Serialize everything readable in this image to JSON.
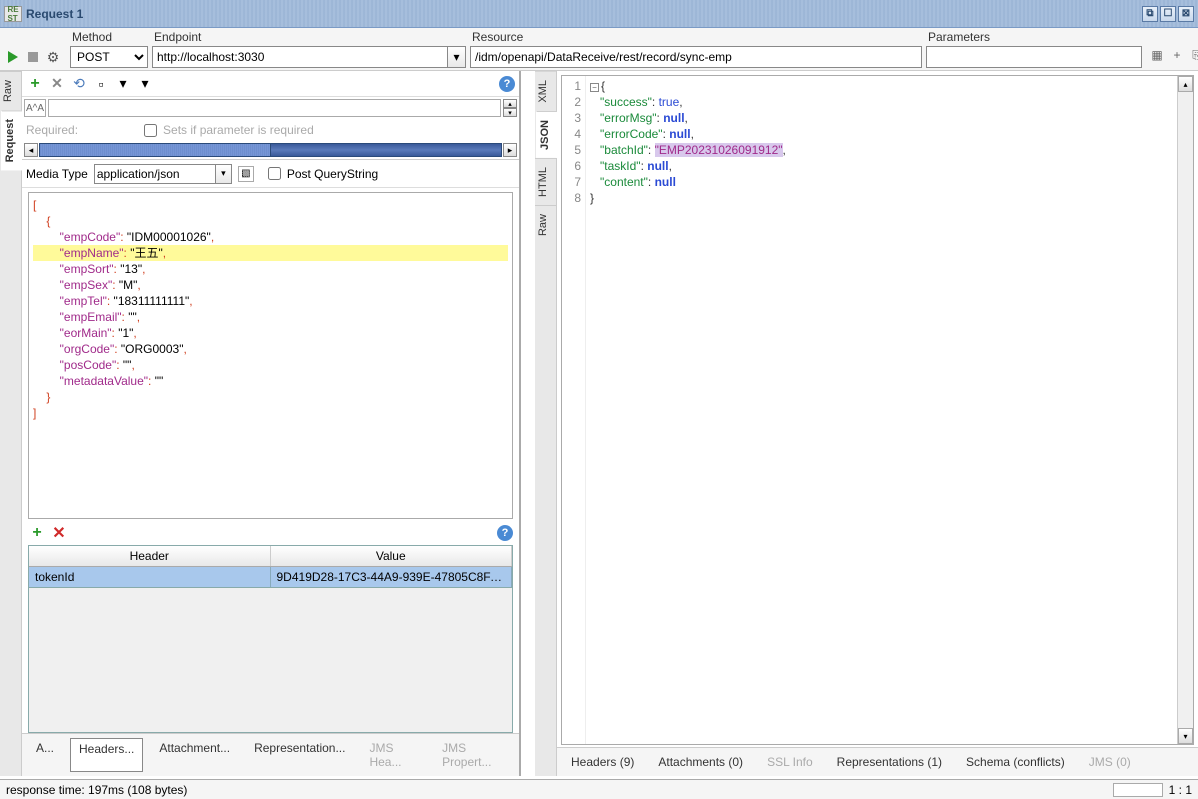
{
  "title": "Request 1",
  "title_icon": "REST",
  "toolbar": {
    "method_label": "Method",
    "method_value": "POST",
    "endpoint_label": "Endpoint",
    "endpoint_value": "http://localhost:3030",
    "resource_label": "Resource",
    "resource_value": "/idm/openapi/DataReceive/rest/record/sync-emp",
    "parameters_label": "Parameters",
    "parameters_value": ""
  },
  "left_tabs": {
    "raw": "Raw",
    "request": "Request"
  },
  "required_row": {
    "label": "Required:",
    "hint": "Sets if parameter is required"
  },
  "media_type": {
    "label": "Media Type",
    "value": "application/json",
    "post_qs": "Post QueryString"
  },
  "request_body": {
    "lines": [
      "[",
      "    {",
      "        \"empCode\": \"IDM00001026\",",
      "        \"empName\": \"王五\",",
      "        \"empSort\": \"13\",",
      "        \"empSex\": \"M\",",
      "        \"empTel\": \"18311111111\",",
      "        \"empEmail\": \"\",",
      "        \"eorMain\": \"1\",",
      "        \"orgCode\": \"ORG0003\",",
      "        \"posCode\": \"\",",
      "        \"metadataValue\": \"\"",
      "    }",
      "]"
    ],
    "highlight_index": 3
  },
  "headers_table": {
    "col_header": "Header",
    "col_value": "Value",
    "rows": [
      {
        "header": "tokenId",
        "value": "9D419D28-17C3-44A9-939E-47805C8FAC..."
      }
    ]
  },
  "left_bottom_tabs": {
    "auth": "A...",
    "headers": "Headers...",
    "attachment": "Attachment...",
    "representation": "Representation...",
    "jms_hea": "JMS Hea...",
    "jms_prop": "JMS Propert..."
  },
  "right_tabs": {
    "xml": "XML",
    "json": "JSON",
    "html": "HTML",
    "raw": "Raw"
  },
  "response": {
    "lines": [
      {
        "n": 1,
        "raw": "{",
        "fold": true
      },
      {
        "n": 2,
        "key": "success",
        "val": "true",
        "type": "bool"
      },
      {
        "n": 3,
        "key": "errorMsg",
        "val": "null",
        "type": "null"
      },
      {
        "n": 4,
        "key": "errorCode",
        "val": "null",
        "type": "null"
      },
      {
        "n": 5,
        "key": "batchId",
        "val": "EMP20231026091912",
        "type": "str",
        "selected": true
      },
      {
        "n": 6,
        "key": "taskId",
        "val": "null",
        "type": "null"
      },
      {
        "n": 7,
        "key": "content",
        "val": "null",
        "type": "null",
        "last": true
      },
      {
        "n": 8,
        "raw": "}"
      }
    ]
  },
  "right_bottom_tabs": {
    "headers": "Headers (9)",
    "attachments": "Attachments (0)",
    "ssl": "SSL Info",
    "representations": "Representations (1)",
    "schema": "Schema (conflicts)",
    "jms": "JMS (0)"
  },
  "status": {
    "response_time": "response time: 197ms (108 bytes)",
    "position": "1 : 1"
  }
}
